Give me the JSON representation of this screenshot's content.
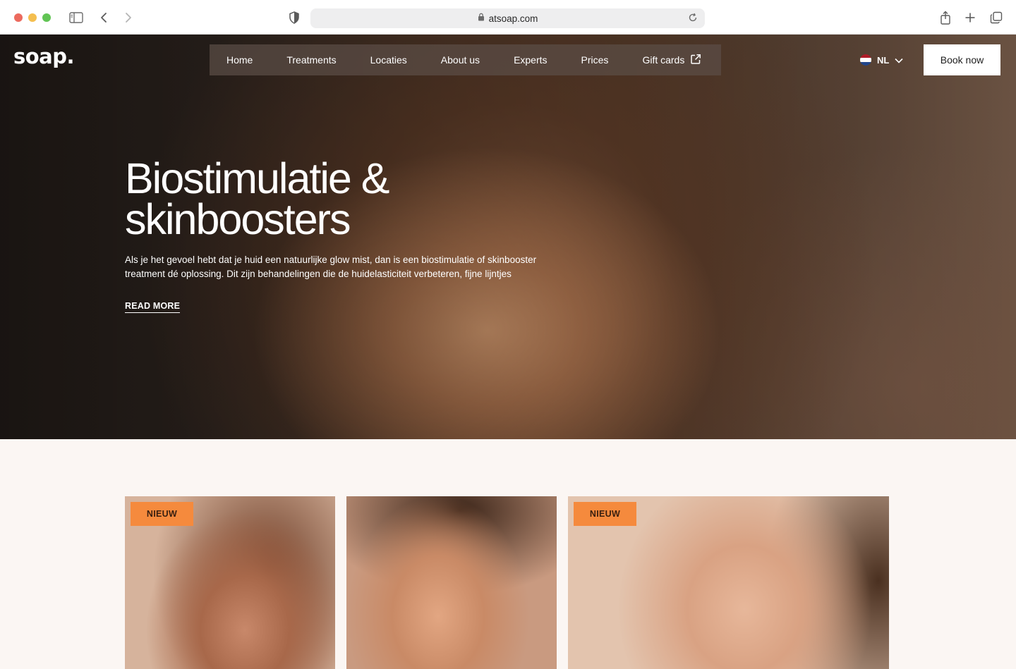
{
  "browser": {
    "url": "atsoap.com",
    "icons": [
      "sidebar-icon",
      "back-icon",
      "forward-icon",
      "shield-icon",
      "lock-icon",
      "reload-icon",
      "share-icon",
      "new-tab-icon",
      "tabs-icon"
    ]
  },
  "site": {
    "logo": "soap.",
    "nav": {
      "items": [
        {
          "label": "Home"
        },
        {
          "label": "Treatments"
        },
        {
          "label": "Locaties"
        },
        {
          "label": "About us"
        },
        {
          "label": "Experts"
        },
        {
          "label": "Prices"
        },
        {
          "label": "Gift cards"
        }
      ]
    },
    "language": "NL",
    "book_label": "Book now"
  },
  "hero": {
    "title_line1": "Biostimulatie &",
    "title_line2": "skinboosters",
    "description": "Als je het gevoel hebt dat je huid een natuurlijke glow mist, dan is een biostimulatie of skinbooster treatment dé oplossing. Dit zijn behandelingen die de huidelasticiteit verbeteren, fijne lijntjes",
    "cta": "READ MORE"
  },
  "cards": [
    {
      "badge": "NIEUW"
    },
    {
      "badge": ""
    },
    {
      "badge": "NIEUW"
    }
  ],
  "colors": {
    "badge": "#f58a3d",
    "nav_bg": "#5c4e46",
    "page_bg": "#fbf6f3"
  }
}
